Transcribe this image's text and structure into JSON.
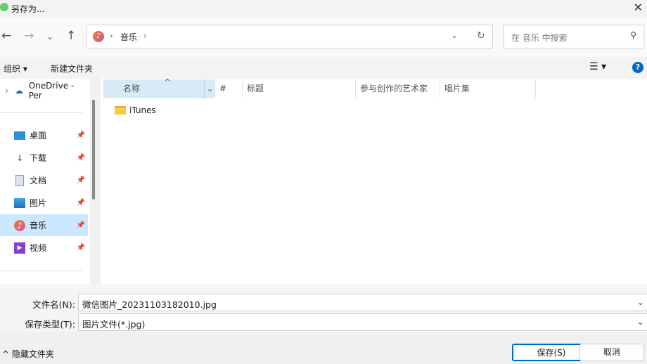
{
  "title": "另存为...",
  "address": {
    "location": "音乐",
    "search_placeholder": "在 音乐 中搜索"
  },
  "toolbar": {
    "organize": "组织",
    "new_folder": "新建文件夹"
  },
  "sidebar": {
    "items": [
      {
        "label": "OneDrive - Per"
      },
      {
        "label": "桌面"
      },
      {
        "label": "下载"
      },
      {
        "label": "文档"
      },
      {
        "label": "图片"
      },
      {
        "label": "音乐"
      },
      {
        "label": "视频"
      }
    ]
  },
  "columns": [
    "名称",
    "#",
    "标题",
    "参与创作的艺术家",
    "唱片集"
  ],
  "files": [
    {
      "name": "iTunes"
    }
  ],
  "form": {
    "filename_label": "文件名(N):",
    "filename": "微信图片_20231103182010.jpg",
    "type_label": "保存类型(T):",
    "type": "图片文件(*.jpg)"
  },
  "footer": {
    "hide_folders": "隐藏文件夹",
    "save": "保存(S)",
    "cancel": "取消"
  }
}
